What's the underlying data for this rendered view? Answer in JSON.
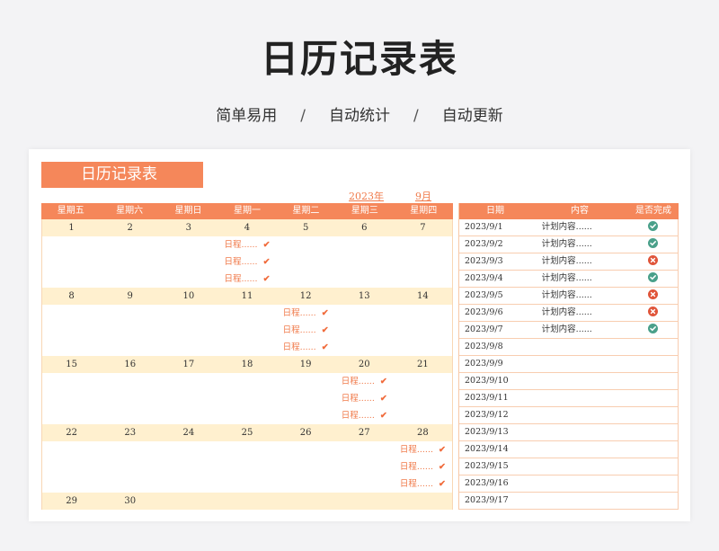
{
  "hero": {
    "title": "日历记录表",
    "sub1": "简单易用",
    "sep": "/",
    "sub2": "自动统计",
    "sub3": "自动更新"
  },
  "sheet": {
    "title": "日历记录表",
    "year": "2023年",
    "month": "9月"
  },
  "calendar": {
    "weekdays": [
      "星期五",
      "星期六",
      "星期日",
      "星期一",
      "星期二",
      "星期三",
      "星期四"
    ],
    "schedule_text": "日程......",
    "check": "✔",
    "weeks": [
      {
        "dates": [
          "1",
          "2",
          "3",
          "4",
          "5",
          "6",
          "7"
        ],
        "schedule_col": 3
      },
      {
        "dates": [
          "8",
          "9",
          "10",
          "11",
          "12",
          "13",
          "14"
        ],
        "schedule_col": 4
      },
      {
        "dates": [
          "15",
          "16",
          "17",
          "18",
          "19",
          "20",
          "21"
        ],
        "schedule_col": 5
      },
      {
        "dates": [
          "22",
          "23",
          "24",
          "25",
          "26",
          "27",
          "28"
        ],
        "schedule_col": 6
      },
      {
        "dates": [
          "29",
          "30",
          "",
          "",
          "",
          "",
          ""
        ],
        "schedule_col": -1
      }
    ]
  },
  "table": {
    "headers": {
      "date": "日期",
      "content": "内容",
      "status": "是否完成"
    },
    "rows": [
      {
        "date": "2023/9/1",
        "content": "计划内容......",
        "status": "done"
      },
      {
        "date": "2023/9/2",
        "content": "计划内容......",
        "status": "done"
      },
      {
        "date": "2023/9/3",
        "content": "计划内容......",
        "status": "not-done"
      },
      {
        "date": "2023/9/4",
        "content": "计划内容......",
        "status": "done"
      },
      {
        "date": "2023/9/5",
        "content": "计划内容......",
        "status": "not-done"
      },
      {
        "date": "2023/9/6",
        "content": "计划内容......",
        "status": "not-done"
      },
      {
        "date": "2023/9/7",
        "content": "计划内容......",
        "status": "done"
      },
      {
        "date": "2023/9/8",
        "content": "",
        "status": ""
      },
      {
        "date": "2023/9/9",
        "content": "",
        "status": ""
      },
      {
        "date": "2023/9/10",
        "content": "",
        "status": ""
      },
      {
        "date": "2023/9/11",
        "content": "",
        "status": ""
      },
      {
        "date": "2023/9/12",
        "content": "",
        "status": ""
      },
      {
        "date": "2023/9/13",
        "content": "",
        "status": ""
      },
      {
        "date": "2023/9/14",
        "content": "",
        "status": ""
      },
      {
        "date": "2023/9/15",
        "content": "",
        "status": ""
      },
      {
        "date": "2023/9/16",
        "content": "",
        "status": ""
      },
      {
        "date": "2023/9/17",
        "content": "",
        "status": ""
      }
    ]
  },
  "colors": {
    "accent": "#f5875a",
    "date_row": "#fff0cf",
    "done": "#4aa08a",
    "not_done": "#e0553a"
  }
}
